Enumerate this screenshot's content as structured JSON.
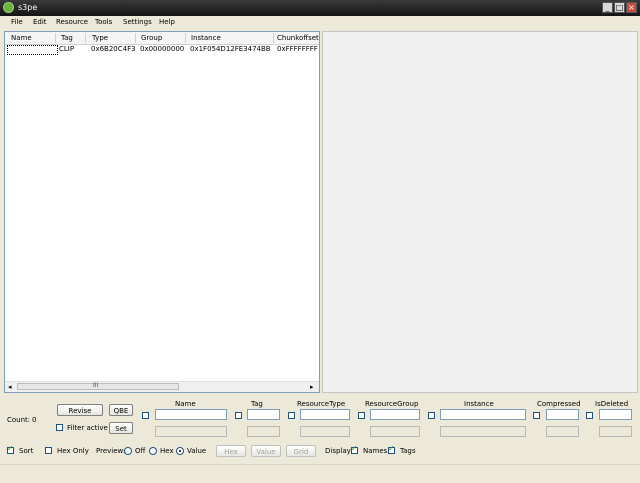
{
  "window": {
    "title": "s3pe"
  },
  "menu": [
    "File",
    "Edit",
    "Resource",
    "Tools",
    "Settings",
    "Help"
  ],
  "list": {
    "columns": [
      "Name",
      "Tag",
      "Type",
      "Group",
      "Instance",
      "Chunkoffset"
    ],
    "rows": [
      {
        "name": "",
        "tag": "CLIP",
        "type": "0x6B20C4F3",
        "group": "0x00000000",
        "instance": "0x1F054D12FE3474BB",
        "chunkoffset": "0xFFFFFFFF"
      }
    ],
    "scroll_grip": "III"
  },
  "bottom": {
    "count_label": "Count:",
    "count_value": "0",
    "revise_label": "Revise",
    "qbe_label": "QBE",
    "set_label": "Set",
    "filter_active_label": "Filter active",
    "filter_headers": [
      "Name",
      "Tag",
      "ResourceType",
      "ResourceGroup",
      "Instance",
      "Compressed",
      "IsDeleted"
    ],
    "sort_label": "Sort",
    "hex_only_label": "Hex Only",
    "preview_label": "Preview:",
    "off_label": "Off",
    "hex_label": "Hex",
    "value_label": "Value",
    "hex_button": "Hex",
    "value_button": "Value",
    "grid_button": "Grid",
    "display_label": "Display:",
    "names_label": "Names",
    "tags_label": "Tags"
  }
}
